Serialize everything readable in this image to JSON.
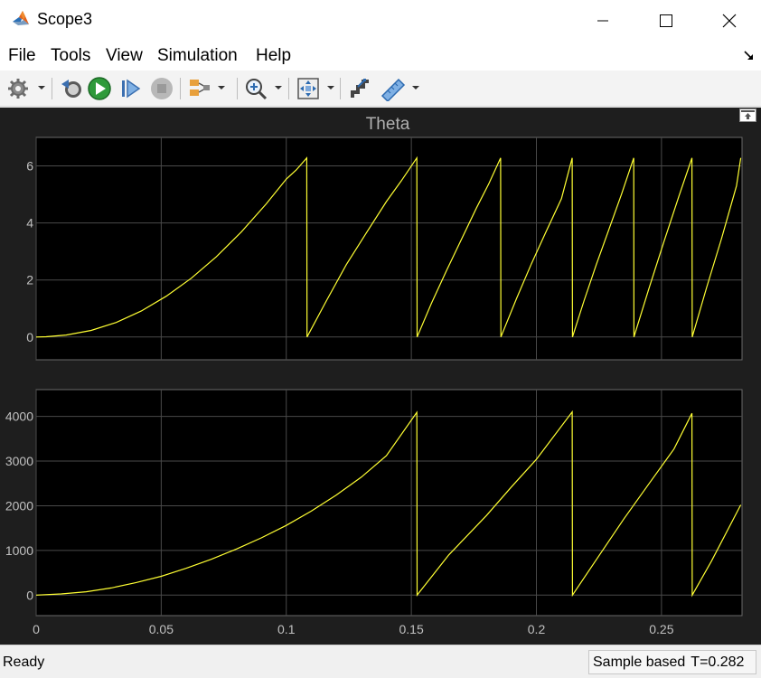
{
  "window": {
    "title": "Scope3"
  },
  "menu": {
    "items": [
      "File",
      "Tools",
      "View",
      "Simulation",
      "Help"
    ]
  },
  "toolbar": {
    "icons": [
      "gear-icon",
      "step-back-icon",
      "run-icon",
      "step-forward-icon",
      "stop-icon",
      "signal-select-icon",
      "zoom-in-icon",
      "fit-to-view-icon",
      "cursor-measure-icon",
      "ruler-measure-icon"
    ]
  },
  "plot": {
    "title": "Theta",
    "colors": {
      "background": "#000000",
      "trace": "#ffff33",
      "grid": "#4a4a4a",
      "frame": "#1e1e1e"
    }
  },
  "chart_data": [
    {
      "type": "line",
      "title": "Theta",
      "xlabel": "",
      "ylabel": "",
      "xlim": [
        0,
        0.2822
      ],
      "ylim": [
        -0.8,
        7.0
      ],
      "y_ticks": [
        0,
        2,
        4,
        6
      ],
      "grid": true,
      "legend": "none",
      "series": [
        {
          "x": [
            0,
            0.004,
            0.012,
            0.022,
            0.032,
            0.042,
            0.052,
            0.062,
            0.072,
            0.082,
            0.092,
            0.1,
            0.104,
            0.1082,
            0.1083,
            0.116,
            0.124,
            0.132,
            0.14,
            0.146,
            0.1522,
            0.1523,
            0.158,
            0.164,
            0.17,
            0.176,
            0.181,
            0.1857,
            0.1858,
            0.192,
            0.198,
            0.204,
            0.21,
            0.2143,
            0.2144,
            0.219,
            0.224,
            0.229,
            0.234,
            0.2389,
            0.239,
            0.245,
            0.251,
            0.257,
            0.2622,
            0.2623,
            0.268,
            0.274,
            0.28,
            0.2817
          ],
          "y": [
            0.0,
            0.01,
            0.07,
            0.23,
            0.51,
            0.91,
            1.43,
            2.06,
            2.81,
            3.68,
            4.67,
            5.54,
            5.86,
            6.28,
            0.0,
            1.26,
            2.54,
            3.65,
            4.75,
            5.48,
            6.28,
            0.0,
            1.18,
            2.32,
            3.42,
            4.52,
            5.38,
            6.28,
            0.0,
            1.34,
            2.57,
            3.72,
            4.85,
            6.28,
            0.0,
            1.26,
            2.55,
            3.78,
            5.0,
            6.28,
            0.0,
            1.7,
            3.35,
            4.95,
            6.28,
            0.0,
            1.72,
            3.45,
            5.3,
            6.28
          ]
        }
      ]
    },
    {
      "type": "line",
      "title": "",
      "xlabel": "",
      "ylabel": "",
      "xlim": [
        0,
        0.2822
      ],
      "ylim": [
        -460,
        4600
      ],
      "y_ticks": [
        0,
        1000,
        2000,
        3000,
        4000
      ],
      "x_ticks": [
        "0",
        "0.05",
        "0.1",
        "0.15",
        "0.2",
        "0.25"
      ],
      "x_tick_values": [
        0,
        0.05,
        0.1,
        0.15,
        0.2,
        0.25
      ],
      "grid": true,
      "legend": "none",
      "series": [
        {
          "x": [
            0,
            0.01,
            0.02,
            0.03,
            0.04,
            0.05,
            0.06,
            0.07,
            0.08,
            0.09,
            0.1,
            0.11,
            0.12,
            0.13,
            0.14,
            0.1522,
            0.1523,
            0.165,
            0.18,
            0.19,
            0.2,
            0.2143,
            0.2144,
            0.225,
            0.235,
            0.245,
            0.255,
            0.2622,
            0.2623,
            0.27,
            0.2817
          ],
          "y": [
            0,
            25,
            75,
            160,
            280,
            420,
            600,
            800,
            1030,
            1280,
            1560,
            1880,
            2240,
            2640,
            3120,
            4090,
            0,
            900,
            1780,
            2420,
            3040,
            4100,
            0,
            880,
            1710,
            2490,
            3270,
            4070,
            0,
            760,
            2020
          ]
        }
      ]
    }
  ],
  "status": {
    "left": "Ready",
    "right": "Sample based",
    "time": "T=0.282"
  }
}
